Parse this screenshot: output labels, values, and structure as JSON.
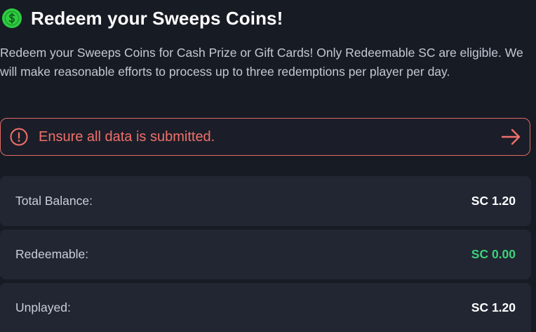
{
  "header": {
    "title": "Redeem your Sweeps Coins!",
    "icon": "dollar-coin-icon",
    "icon_color": "#2ecc40"
  },
  "description": "Redeem your Sweeps Coins for Cash Prize or Gift Cards! Only Redeemable SC are eligible. We will make reasonable efforts to process up to three redemptions per player per day.",
  "alert": {
    "message": "Ensure all data is submitted.",
    "icon": "info-circle-icon",
    "action_icon": "arrow-right-icon",
    "color": "#f0706b"
  },
  "balances": [
    {
      "label": "Total Balance:",
      "value": "SC 1.20",
      "value_color": "#ffffff"
    },
    {
      "label": "Redeemable:",
      "value": "SC 0.00",
      "value_color": "#3cd17a"
    },
    {
      "label": "Unplayed:",
      "value": "SC 1.20",
      "value_color": "#ffffff"
    }
  ]
}
